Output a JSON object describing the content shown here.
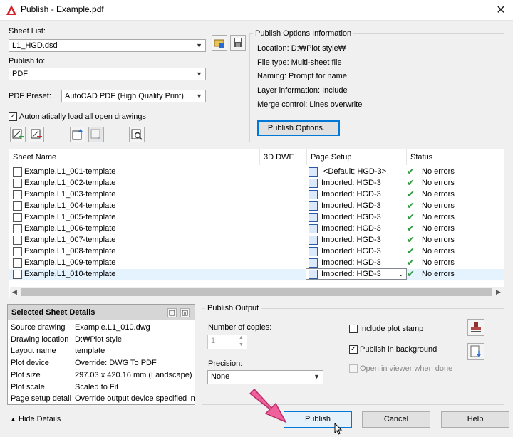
{
  "window": {
    "title": "Publish - Example.pdf",
    "close_glyph": "✕"
  },
  "sheet_list": {
    "label": "Sheet List:",
    "value": "L1_HGD.dsd"
  },
  "publish_to": {
    "label": "Publish to:",
    "value": "PDF"
  },
  "pdf_preset": {
    "label": "PDF Preset:",
    "value": "AutoCAD PDF (High Quality Print)"
  },
  "auto_load": {
    "label": "Automatically load all open drawings",
    "checked": true
  },
  "publish_options_info": {
    "title": "Publish Options Information",
    "lines": [
      "Location: D:₩Plot style₩",
      "File type: Multi-sheet file",
      "Naming: Prompt for name",
      "Layer information: Include",
      "Merge control: Lines overwrite"
    ],
    "button": "Publish Options..."
  },
  "sheet_table": {
    "columns": [
      "Sheet Name",
      "3D DWF",
      "Page Setup",
      "Status"
    ],
    "rows": [
      {
        "name": "Example.L1_001-template",
        "page_setup": "<Default: HGD-3>",
        "status": "No errors"
      },
      {
        "name": "Example.L1_002-template",
        "page_setup": "Imported: HGD-3",
        "status": "No errors"
      },
      {
        "name": "Example.L1_003-template",
        "page_setup": "Imported: HGD-3",
        "status": "No errors"
      },
      {
        "name": "Example.L1_004-template",
        "page_setup": "Imported: HGD-3",
        "status": "No errors"
      },
      {
        "name": "Example.L1_005-template",
        "page_setup": "Imported: HGD-3",
        "status": "No errors"
      },
      {
        "name": "Example.L1_006-template",
        "page_setup": "Imported: HGD-3",
        "status": "No errors"
      },
      {
        "name": "Example.L1_007-template",
        "page_setup": "Imported: HGD-3",
        "status": "No errors"
      },
      {
        "name": "Example.L1_008-template",
        "page_setup": "Imported: HGD-3",
        "status": "No errors"
      },
      {
        "name": "Example.L1_009-template",
        "page_setup": "Imported: HGD-3",
        "status": "No errors"
      },
      {
        "name": "Example.L1_010-template",
        "page_setup": "Imported: HGD-3",
        "status": "No errors",
        "selected": true
      }
    ]
  },
  "selected_details": {
    "title": "Selected Sheet Details",
    "rows": [
      {
        "label": "Source drawing",
        "value": "Example.L1_010.dwg"
      },
      {
        "label": "Drawing location",
        "value": "D:₩Plot style"
      },
      {
        "label": "Layout name",
        "value": "template"
      },
      {
        "label": "Plot device",
        "value": "Override: DWG To PDF"
      },
      {
        "label": "Plot size",
        "value": "297.03 x 420.16 mm (Landscape)"
      },
      {
        "label": "Plot scale",
        "value": "Scaled to Fit"
      },
      {
        "label": "Page setup detail",
        "value": "Override output device specified in ..."
      }
    ]
  },
  "publish_output": {
    "title": "Publish Output",
    "copies_label": "Number of copies:",
    "copies_value": "1",
    "precision_label": "Precision:",
    "precision_value": "None",
    "include_plot_stamp": {
      "label": "Include plot stamp",
      "checked": false
    },
    "publish_in_background": {
      "label": "Publish in background",
      "checked": true
    },
    "open_in_viewer": {
      "label": "Open in viewer when done",
      "checked": false,
      "disabled": true
    }
  },
  "footer": {
    "hide_details": "Hide Details",
    "publish": "Publish",
    "cancel": "Cancel",
    "help": "Help"
  },
  "colors": {
    "accent_arrow": "#f0609a",
    "check_green": "#2e9b3c",
    "autodesk_red": "#d2232a"
  }
}
